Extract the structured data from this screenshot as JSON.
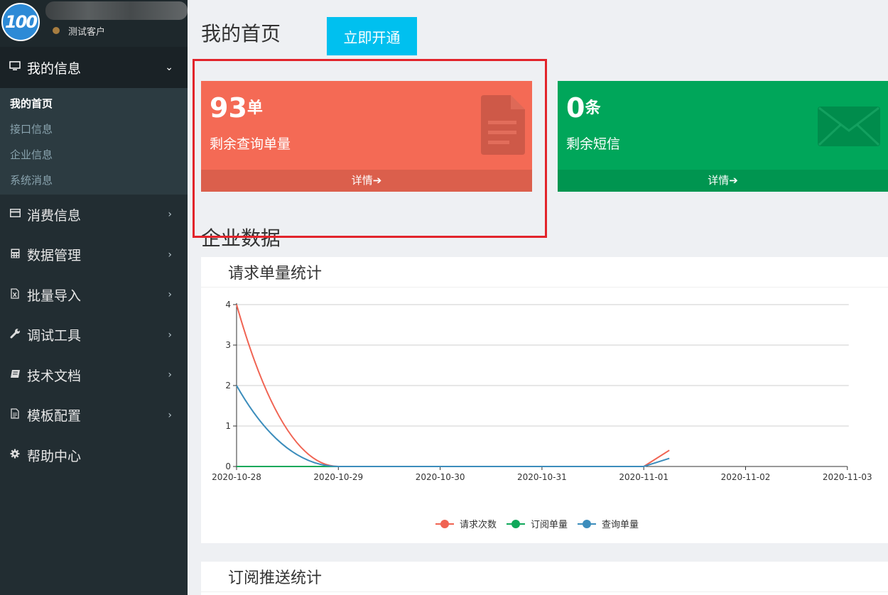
{
  "sidebar": {
    "client_label": "测试客户",
    "logo_text": "100",
    "active_menu": {
      "label": "我的信息",
      "icon": "monitor-icon"
    },
    "submenu": [
      {
        "label": "我的首页",
        "active": true
      },
      {
        "label": "接口信息",
        "active": false
      },
      {
        "label": "企业信息",
        "active": false
      },
      {
        "label": "系统消息",
        "active": false
      }
    ],
    "items": [
      {
        "label": "消费信息",
        "icon": "credit-card-icon"
      },
      {
        "label": "数据管理",
        "icon": "calculator-icon"
      },
      {
        "label": "批量导入",
        "icon": "excel-file-icon"
      },
      {
        "label": "调试工具",
        "icon": "wrench-icon"
      },
      {
        "label": "技术文档",
        "icon": "book-icon"
      },
      {
        "label": "模板配置",
        "icon": "document-icon"
      },
      {
        "label": "帮助中心",
        "icon": "gear-icon"
      }
    ]
  },
  "header": {
    "title": "我的首页",
    "open_button": "立即开通"
  },
  "cards": {
    "orders": {
      "number": "93",
      "unit": "单",
      "desc": "剩余查询单量",
      "footer": "详情",
      "color": "#f46a55"
    },
    "sms": {
      "number": "0",
      "unit": "条",
      "desc": "剩余短信",
      "footer": "详情",
      "color": "#00a65a"
    }
  },
  "section_title": "企业数据",
  "panels": {
    "request_stats": "请求单量统计",
    "push_stats": "订阅推送统计"
  },
  "chart_data": {
    "type": "line",
    "categories": [
      "2020-10-28",
      "2020-10-29",
      "2020-10-30",
      "2020-10-31",
      "2020-11-01",
      "2020-11-02",
      "2020-11-03"
    ],
    "ylim": [
      0,
      4
    ],
    "yticks": [
      0,
      1,
      2,
      3,
      4
    ],
    "grid": true,
    "legend": "bottom-center",
    "series": [
      {
        "name": "请求次数",
        "color": "#f06352",
        "values": [
          4,
          0,
          0,
          0,
          0,
          0.4,
          null
        ]
      },
      {
        "name": "订阅单量",
        "color": "#10a85a",
        "values": [
          0,
          0,
          0,
          0,
          0,
          null,
          null
        ]
      },
      {
        "name": "查询单量",
        "color": "#3c8dbc",
        "values": [
          2,
          0,
          0,
          0,
          0,
          0.2,
          null
        ]
      }
    ]
  }
}
